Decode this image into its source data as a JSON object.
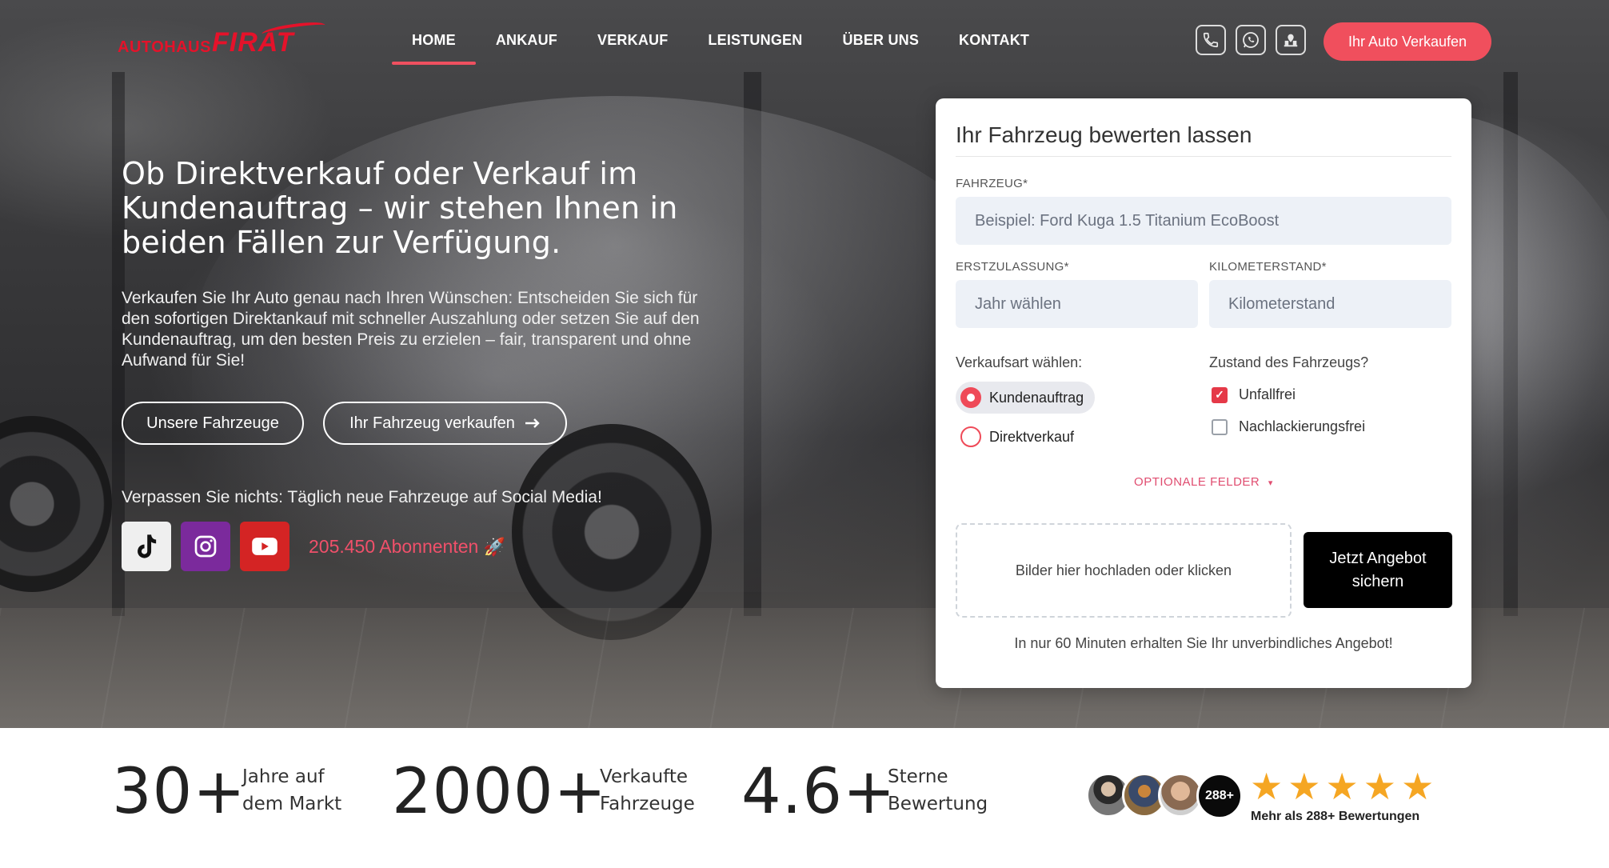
{
  "brand": {
    "logo_part1": "AUTOHAUS",
    "logo_part2": "FIRAT",
    "accent_color": "#f04f5d"
  },
  "nav": {
    "items": [
      "HOME",
      "ANKAUF",
      "VERKAUF",
      "LEISTUNGEN",
      "ÜBER UNS",
      "KONTAKT"
    ],
    "active": "HOME",
    "icons": [
      "phone-icon",
      "whatsapp-icon",
      "location-icon"
    ],
    "cta": "Ihr Auto Verkaufen"
  },
  "hero": {
    "headline": "Ob Direktverkauf oder Verkauf im Kundenauftrag – wir stehen Ihnen in beiden Fällen zur Verfügung.",
    "text": "Verkaufen Sie Ihr Auto genau nach Ihren Wünschen: Entscheiden Sie sich für den sofortigen Direktankauf mit schneller Auszahlung oder setzen Sie auf den Kundenauftrag, um den besten Preis zu erzielen – fair, transparent und ohne Aufwand für Sie!",
    "btn_vehicles": "Unsere Fahrzeuge",
    "btn_sell": "Ihr Fahrzeug verkaufen",
    "social_text": "Verpassen Sie nichts: Täglich neue Fahrzeuge auf Social Media!",
    "socials": [
      "tiktok-icon",
      "instagram-icon",
      "youtube-icon"
    ],
    "subscribers": "205.450 Abonnenten"
  },
  "form": {
    "title": "Ihr Fahrzeug bewerten lassen",
    "vehicle_label": "FAHRZEUG*",
    "vehicle_placeholder": "Beispiel: Ford Kuga 1.5 Titanium EcoBoost",
    "reg_label": "ERSTZULASSUNG*",
    "reg_placeholder": "Jahr wählen",
    "km_label": "KILOMETERSTAND*",
    "km_placeholder": "Kilometerstand",
    "sale_type_label": "Verkaufsart wählen:",
    "sale_types": [
      {
        "label": "Kundenauftrag",
        "selected": true
      },
      {
        "label": "Direktverkauf",
        "selected": false
      }
    ],
    "condition_label": "Zustand des Fahrzeugs?",
    "conditions": [
      {
        "label": "Unfallfrei",
        "checked": true
      },
      {
        "label": "Nachlackierungsfrei",
        "checked": false
      }
    ],
    "optional_fields": "OPTIONALE FELDER",
    "upload_text": "Bilder hier hochladen oder klicken",
    "submit": "Jetzt Angebot sichern",
    "note": "In nur 60 Minuten erhalten Sie Ihr unverbindliches Angebot!"
  },
  "stats": [
    {
      "value": "30+",
      "label_line1": "Jahre auf",
      "label_line2": "dem Markt"
    },
    {
      "value": "2000+",
      "label_line1": "Verkaufte",
      "label_line2": "Fahrzeuge"
    },
    {
      "value": "4.6+",
      "label_line1": "Sterne",
      "label_line2": "Bewertung"
    }
  ],
  "reviews": {
    "badge": "288+",
    "rating": 5,
    "text": "Mehr als 288+ Bewertungen"
  }
}
